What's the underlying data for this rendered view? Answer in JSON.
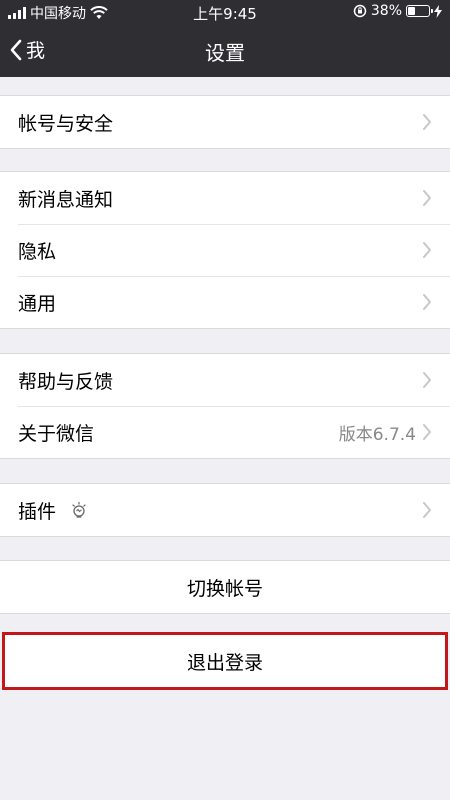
{
  "status_bar": {
    "carrier": "中国移动",
    "time": "上午9:45",
    "battery_percent": "38%",
    "battery_level": 0.38,
    "icons": [
      "signal-icon",
      "wifi-icon",
      "rotation-lock-icon",
      "battery-icon",
      "charging-icon"
    ]
  },
  "nav": {
    "back_label": "我",
    "title": "设置"
  },
  "groups": [
    {
      "items": [
        {
          "label": "帐号与安全"
        }
      ]
    },
    {
      "items": [
        {
          "label": "新消息通知"
        },
        {
          "label": "隐私"
        },
        {
          "label": "通用"
        }
      ]
    },
    {
      "items": [
        {
          "label": "帮助与反馈"
        },
        {
          "label": "关于微信",
          "value": "版本6.7.4"
        }
      ]
    },
    {
      "items": [
        {
          "label": "插件",
          "icon": "lightbulb-icon"
        }
      ]
    }
  ],
  "switch_account": {
    "label": "切换帐号"
  },
  "logout": {
    "label": "退出登录"
  },
  "colors": {
    "nav_bg": "#2e2e33",
    "page_bg": "#efeff4",
    "highlight": "#c2181b"
  }
}
